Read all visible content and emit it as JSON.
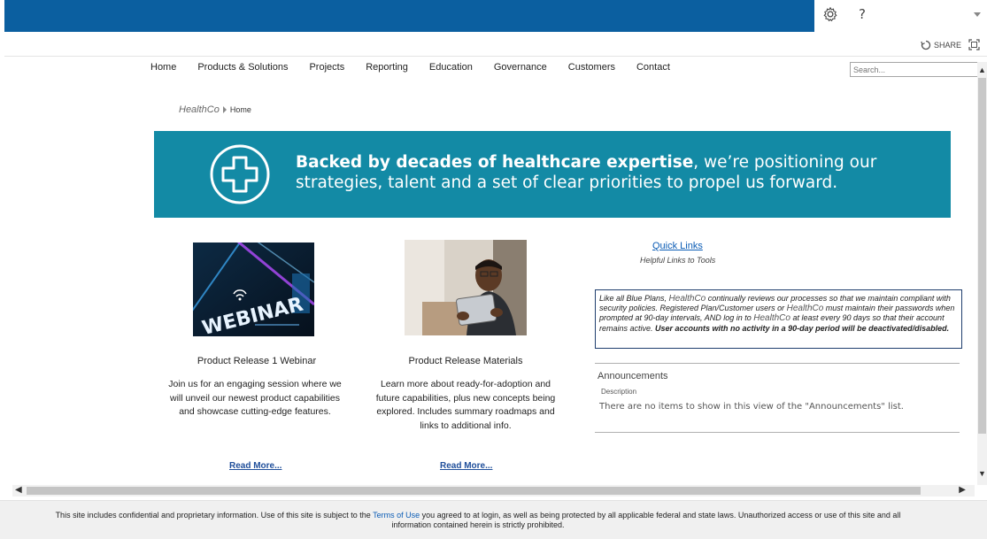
{
  "suite_bar": {
    "settings_icon": "gear-icon",
    "help_label": "?",
    "menu_caret_icon": "chevron-down-icon"
  },
  "ribbon": {
    "share_label": "SHARE",
    "share_icon": "share-icon",
    "focus_icon": "focus-on-content-icon"
  },
  "top_nav": {
    "items": [
      "Home",
      "Products & Solutions",
      "Projects",
      "Reporting",
      "Education",
      "Governance",
      "Customers",
      "Contact"
    ],
    "search_placeholder": "Search..."
  },
  "breadcrumb": {
    "site": "HealthCo",
    "page": "Home"
  },
  "banner": {
    "bold_text": "Backed by decades of healthcare expertise",
    "rest_line1": ", we’re positioning our",
    "line2": "strategies, talent and a set of clear priorities to propel us forward.",
    "icon": "medical-cross-icon",
    "colors": {
      "background": "#138aa5",
      "text": "#ffffff"
    }
  },
  "cards": [
    {
      "image_text": "WEBINAR",
      "title": "Product Release 1 Webinar",
      "description_lines": [
        "Join us for an engaging session where we",
        "will unveil our newest product capabilities",
        "and showcase cutting-edge features."
      ],
      "link": "Read More..."
    },
    {
      "title": "Product Release Materials",
      "description_lines": [
        "Learn more about ready-for-adoption and",
        "future capabilities, plus new concepts being",
        "explored. Includes summary roadmaps and",
        "links to additional info."
      ],
      "link": "Read More..."
    }
  ],
  "quick_links": {
    "label": "Quick Links",
    "subtitle": "Helpful Links to Tools"
  },
  "notice": {
    "part1": "Like all Blue Plans, ",
    "org1": "HealthCo",
    "part2": " continually reviews our processes so that we maintain compliant with security policies. Registered Plan/Customer users or ",
    "org2": "HealthCo",
    "part3": " must maintain their passwords when prompted at 90-day intervals, AND log in to ",
    "org3": "HealthCo",
    "part4": " at least every 90 days so that their account remains active. ",
    "bold": "User accounts with no activity in a 90-day period will be deactivated/disabled."
  },
  "announcements": {
    "title": "Announcements",
    "column": "Description",
    "empty_message": "There are no items to show in this view of the \"Announcements\" list."
  },
  "footer": {
    "text_before_link": "This site includes confidential and proprietary information. Use of this site is subject to the ",
    "link": "Terms of Use",
    "text_after_link": " you agreed to at login, as well as being protected by all applicable federal and state laws. Unauthorized access or use of this site and all information contained herein is strictly prohibited."
  },
  "colors": {
    "suite_bar": "#0b5fa0",
    "link": "#0b5cb5"
  }
}
